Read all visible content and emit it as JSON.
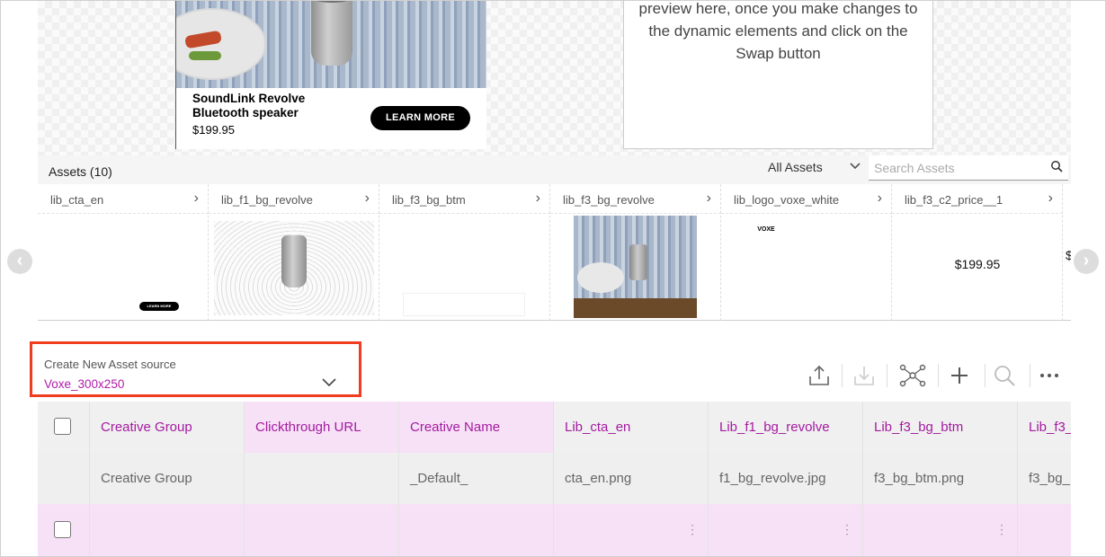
{
  "preview": {
    "ad": {
      "title": "SoundLink Revolve Bluetooth speaker",
      "price": "$199.95",
      "cta": "LEARN MORE"
    },
    "message": "preview here, once you make changes to the dynamic elements and click on the Swap button"
  },
  "assets": {
    "title": "Assets (10)",
    "filter_value": "All Assets",
    "search_placeholder": "Search Assets",
    "columns": [
      {
        "label": "lib_cta_en",
        "thumb": "mini-cta",
        "thumb_text": "LEARN MORE"
      },
      {
        "label": "lib_f1_bg_revolve",
        "thumb": "speaker-render"
      },
      {
        "label": "lib_f3_bg_btm",
        "thumb": "white-block"
      },
      {
        "label": "lib_f3_bg_revolve",
        "thumb": "table-photo"
      },
      {
        "label": "lib_logo_voxe_white",
        "thumb": "logo",
        "thumb_text": "VOXE"
      },
      {
        "label": "lib_f3_c2_price__1",
        "thumb": "text",
        "thumb_text": "$199.95"
      }
    ],
    "next_partial_text": "$"
  },
  "source": {
    "label": "Create New Asset source",
    "value": "Voxe_300x250"
  },
  "toolbar": {
    "icons": [
      "upload-icon",
      "download-icon",
      "network-icon",
      "add-icon",
      "search-icon",
      "more-icon"
    ]
  },
  "grid": {
    "headers": [
      "Creative Group",
      "Clickthrough URL",
      "Creative Name",
      "Lib_cta_en",
      "Lib_f1_bg_revolve",
      "Lib_f3_bg_btm",
      "Lib_f3_"
    ],
    "row1": [
      "Creative Group",
      "",
      "_Default_",
      "cta_en.png",
      "f1_bg_revolve.jpg",
      "f3_bg_btm.png",
      "f3_bg_"
    ]
  },
  "colors": {
    "accent": "#a41aa0",
    "highlight_border": "#f03c1f",
    "pink_cell": "#f7e1f6"
  }
}
